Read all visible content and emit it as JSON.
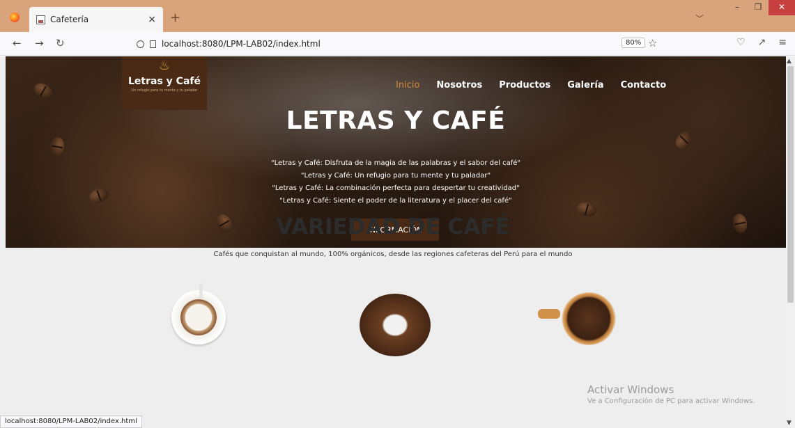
{
  "browser": {
    "tab_title": "Cafetería",
    "tab_close": "×",
    "new_tab": "+",
    "list_tabs": "﹀",
    "url": "localhost:8080/LPM-LAB02/index.html",
    "zoom": "80%",
    "status_url": "localhost:8080/LPM-LAB02/index.html"
  },
  "site": {
    "logo_name": "Letras y Café",
    "logo_tagline": "Un refugio para tu mente y tu paladar",
    "menu": [
      "Inicio",
      "Nosotros",
      "Productos",
      "Galería",
      "Contacto"
    ],
    "hero_title": "LETRAS Y CAFÉ",
    "quotes": [
      "\"Letras y Café: Disfruta de la magia de las palabras y el sabor del café\"",
      "\"Letras y Café: Un refugio para tu mente y tu paladar\"",
      "\"Letras y Café: La combinación perfecta para despertar tu creatividad\"",
      "\"Letras y Café: Siente el poder de la literatura y el placer del café\""
    ],
    "info_button": "INFORMACIÓN",
    "section_title": "VARIEDAD DE CAFÉ",
    "section_subtitle": "Cafés que conquistan al mundo, 100% orgánicos, desde las regiones cafeteras del Perú para el mundo"
  },
  "watermark": {
    "line1": "Activar Windows",
    "line2": "Ve a Configuración de PC para activar Windows."
  },
  "colors": {
    "titlebar": "#d9a47c",
    "accent_brown": "#4a2a14",
    "active_menu": "#d58a3b"
  }
}
